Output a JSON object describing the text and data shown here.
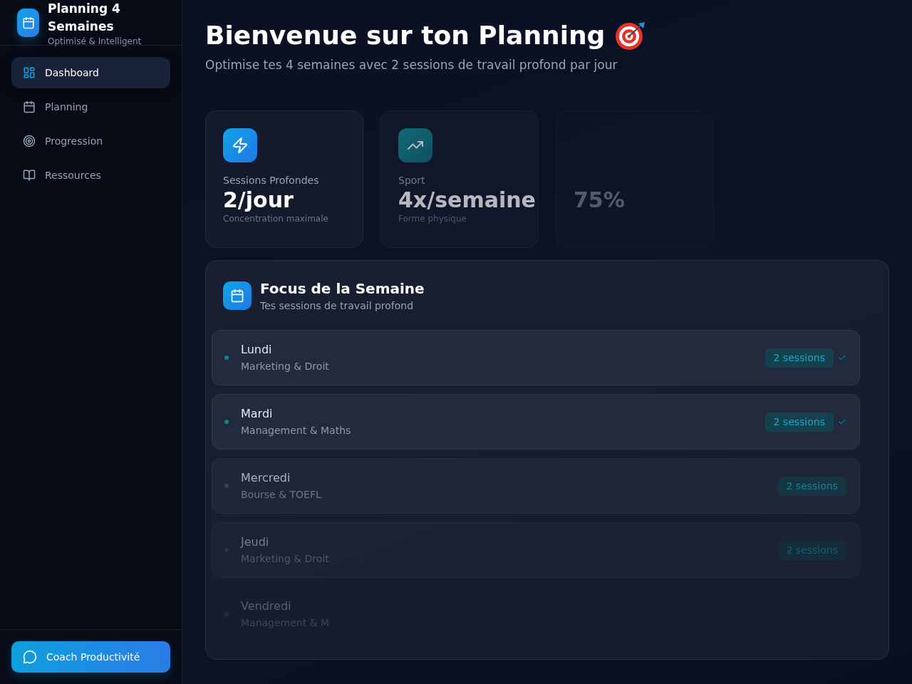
{
  "sidebar": {
    "app_title": "Planning 4 Semaines",
    "app_subtitle": "Optimisé & Intelligent",
    "nav_items": [
      {
        "label": "Dashboard",
        "selected": true
      },
      {
        "label": "Planning",
        "selected": false
      },
      {
        "label": "Progression",
        "selected": false
      },
      {
        "label": "Ressources",
        "selected": false
      }
    ],
    "coach_button": "Coach Productivité"
  },
  "header": {
    "title": "Bienvenue sur ton Planning",
    "subtitle": "Optimise tes 4 semaines avec 2 sessions de travail profond par jour"
  },
  "stats": [
    {
      "kind": "full",
      "label": "Sessions Profondes",
      "value": "2/jour",
      "note": "Concentration maximale"
    },
    {
      "kind": "dim",
      "label": "Sport",
      "value": "4x/semaine",
      "note": "Forme physique"
    },
    {
      "kind": "faint",
      "value": "75%"
    }
  ],
  "focus": {
    "title": "Focus de la Semaine",
    "subtitle": "Tes sessions de travail profond",
    "days": [
      {
        "kind": "full",
        "day": "Lundi",
        "subjects": "Marketing & Droit",
        "badge": "2 sessions",
        "done": true
      },
      {
        "kind": "full",
        "day": "Mardi",
        "subjects": "Management & Maths",
        "badge": "2 sessions",
        "done": true
      },
      {
        "kind": "dim",
        "day": "Mercredi",
        "subjects": "Bourse & TOEFL",
        "badge": "2 sessions",
        "done": false
      },
      {
        "kind": "faded",
        "day": "Jeudi",
        "subjects": "Marketing & Droit",
        "badge": "2 sessions",
        "done": false
      },
      {
        "kind": "faint",
        "day": "Vendredi",
        "subjects": "Management & M",
        "done": false
      }
    ]
  }
}
